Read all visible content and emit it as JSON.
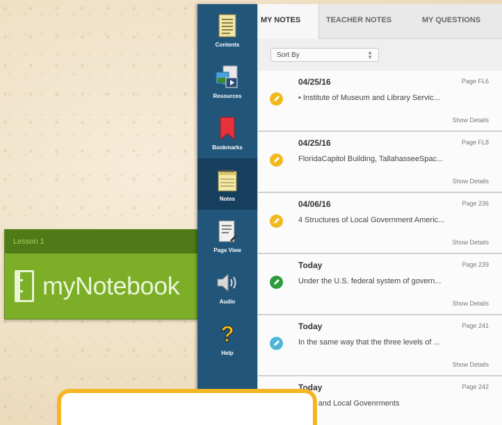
{
  "banner": {
    "subtitle": "Lesson 1",
    "title": "myNotebook",
    "color": "#7cae28"
  },
  "toolbar": {
    "items": [
      {
        "label": "Contents",
        "icon": "contents-icon"
      },
      {
        "label": "Resources",
        "icon": "resources-icon"
      },
      {
        "label": "Bookmarks",
        "icon": "bookmark-icon"
      },
      {
        "label": "Notes",
        "icon": "notes-icon",
        "active": true
      },
      {
        "label": "Page View",
        "icon": "page-view-icon"
      },
      {
        "label": "Audio",
        "icon": "audio-icon"
      },
      {
        "label": "Help",
        "icon": "help-icon"
      }
    ]
  },
  "tabs": [
    {
      "label": "MY NOTES",
      "active": true
    },
    {
      "label": "TEACHER NOTES"
    },
    {
      "label": "MY QUESTIONS"
    }
  ],
  "sort": {
    "label": "Sort By"
  },
  "notes": [
    {
      "date": "04/25/16",
      "page": "Page FL6",
      "text": "• Institute of Museum and Library Servic...",
      "details": "Show Details",
      "color": "#f2b81e"
    },
    {
      "date": "04/25/16",
      "page": "Page FL8",
      "text": "FloridaCapitol Building, TallahasseeSpac...",
      "details": "Show Details",
      "color": "#f2b81e"
    },
    {
      "date": "04/06/16",
      "page": "Page 236",
      "text": "4 Structures of Local Government Americ...",
      "details": "Show Details",
      "color": "#f2b81e"
    },
    {
      "date": "Today",
      "page": "Page 239",
      "text": "Under the U.S. federal system of govern...",
      "details": "Show Details",
      "color": "#2e9a3e"
    },
    {
      "date": "Today",
      "page": "Page 241",
      "text": "In the same way that the three levels of ...",
      "details": "Show Details",
      "color": "#4fb7d6"
    },
    {
      "date": "Today",
      "page": "Page 242",
      "text": "State and Local Govenrments",
      "details": "",
      "color": "#2a8fd0"
    }
  ]
}
